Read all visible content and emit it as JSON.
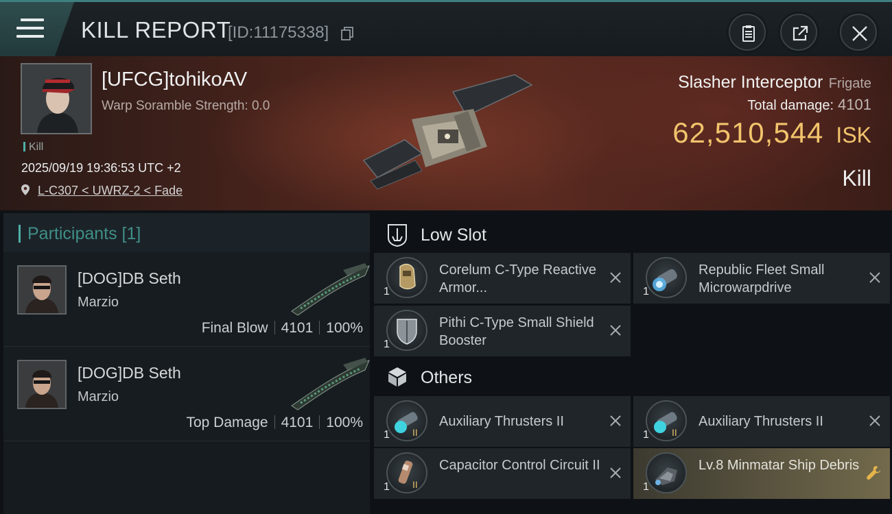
{
  "header": {
    "title": "KILL REPORT",
    "report_id": "[ID:11175338]"
  },
  "victim": {
    "name": "[UFCG]tohikoAV",
    "warp_scramble": "Warp Soramble Strength: 0.0",
    "kill_tag": "Kill",
    "timestamp": "2025/09/19 19:36:53 UTC +2",
    "location": "L-C307 < UWRZ-2 < Fade",
    "ship_name": "Slasher Interceptor",
    "ship_class": "Frigate",
    "total_damage_label": "Total damage:",
    "total_damage": "4101",
    "isk_value": "62,510,544",
    "isk_unit": "ISK",
    "result": "Kill"
  },
  "participants": {
    "title": "Participants [1]",
    "rows": [
      {
        "name": "[DOG]DB Seth",
        "corp": "Marzio",
        "role": "Final Blow",
        "damage": "4101",
        "percent": "100%"
      },
      {
        "name": "[DOG]DB Seth",
        "corp": "Marzio",
        "role": "Top Damage",
        "damage": "4101",
        "percent": "100%"
      }
    ]
  },
  "sections": {
    "low_slot": "Low Slot",
    "others": "Others"
  },
  "modules": {
    "low": [
      {
        "name": "Corelum C-Type Reactive Armor...",
        "qty": "1",
        "icon": "armor-hardener-icon"
      },
      {
        "name": "Republic Fleet Small Microwarpdrive",
        "qty": "1",
        "icon": "microwarpdrive-icon"
      },
      {
        "name": "Pithi C-Type Small Shield Booster",
        "qty": "1",
        "icon": "shield-booster-icon"
      }
    ],
    "others": [
      {
        "name": "Auxiliary Thrusters II",
        "qty": "1",
        "icon": "thruster-rig-icon"
      },
      {
        "name": "Auxiliary Thrusters II",
        "qty": "1",
        "icon": "thruster-rig-icon"
      },
      {
        "name": "Capacitor Control Circuit II",
        "qty": "1",
        "icon": "capacitor-rig-icon"
      },
      {
        "name": "Lv.8 Minmatar Ship Debris",
        "qty": "1",
        "icon": "ship-debris-icon"
      }
    ]
  },
  "colors": {
    "accent_teal": "#4fb1a8",
    "isk_gold": "#f2c46c",
    "highlight_row": "#736a4c"
  }
}
